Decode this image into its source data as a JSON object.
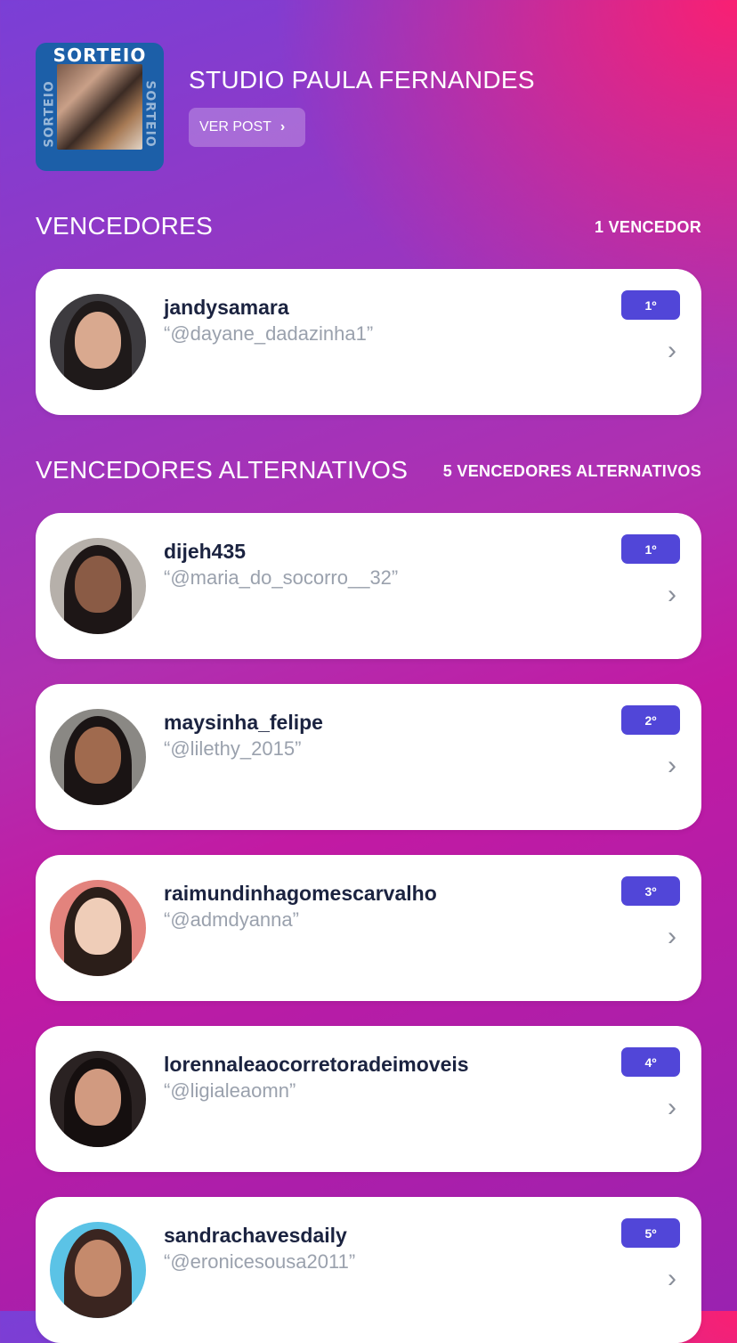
{
  "post": {
    "thumb_title": "SORTEIO",
    "thumb_side": "SORTEIO",
    "studio_name": "STUDIO PAULA FERNANDES",
    "ver_post_label": "VER POST"
  },
  "winners": {
    "title": "VENCEDORES",
    "count": "1 VENCEDOR",
    "items": [
      {
        "username": "jandysamara",
        "comment": "“@dayane_dadazinha1”",
        "rank": "1º"
      }
    ]
  },
  "alternates": {
    "title": "VENCEDORES ALTERNATIVOS",
    "count": "5 VENCEDORES ALTERNATIVOS",
    "items": [
      {
        "username": "dijeh435",
        "comment": "“@maria_do_socorro__32”",
        "rank": "1º"
      },
      {
        "username": "maysinha_felipe",
        "comment": "“@lilethy_2015”",
        "rank": "2º"
      },
      {
        "username": "raimundinhagomescarvalho",
        "comment": "“@admdyanna”",
        "rank": "3º"
      },
      {
        "username": "lorennaleaocorretoradeimoveis",
        "comment": "“@ligialeaomn”",
        "rank": "4º"
      },
      {
        "username": "sandrachavesdaily",
        "comment": "“@eronicesousa2011”",
        "rank": "5º"
      }
    ]
  },
  "colors": {
    "badge": "#5146d8",
    "username": "#1b2340",
    "comment": "#9aa1ad"
  },
  "icons": {
    "ver_post_chevron": "chevron-right-icon",
    "card_chevron": "chevron-right-icon"
  }
}
